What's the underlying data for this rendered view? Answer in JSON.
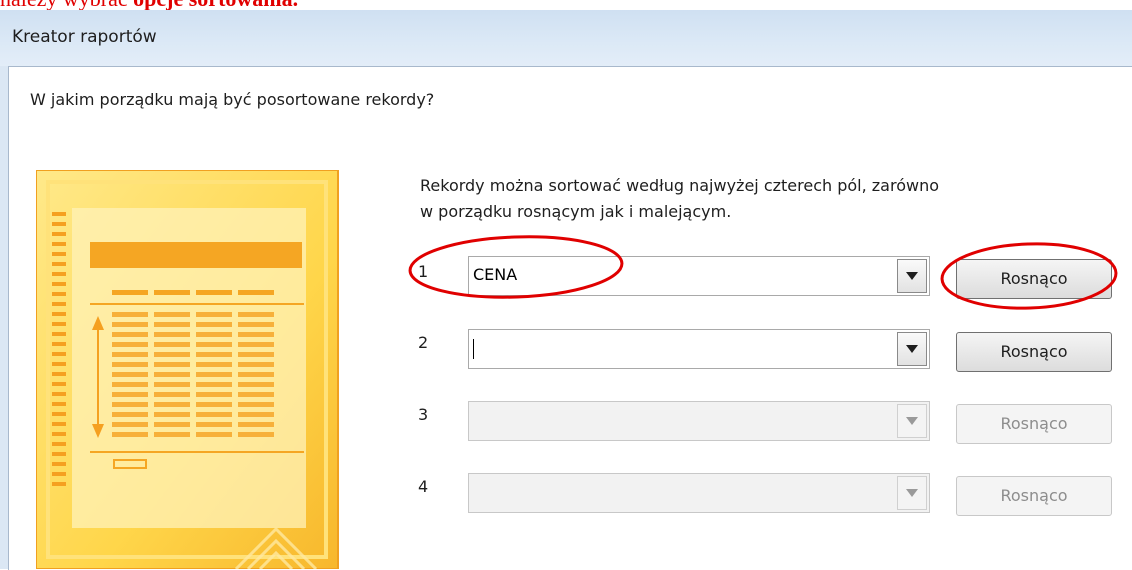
{
  "caption": {
    "plain": "należy wybrać ",
    "bold": "opcje sortowania."
  },
  "window": {
    "title": "Kreator raportów"
  },
  "question": "W jakim porządku mają być posortowane rekordy?",
  "description": "Rekordy można sortować według najwyżej czterech pól, zarówno w porządku rosnącym jak i malejącym.",
  "sort_rows": [
    {
      "number": "1",
      "field": "CENA",
      "order": "Rosnąco",
      "enabled": true
    },
    {
      "number": "2",
      "field": "",
      "order": "Rosnąco",
      "enabled": true
    },
    {
      "number": "3",
      "field": "",
      "order": "Rosnąco",
      "enabled": false
    },
    {
      "number": "4",
      "field": "",
      "order": "Rosnąco",
      "enabled": false
    }
  ],
  "icons": {
    "dropdown": "chevron-down-icon",
    "illustration": "report-layout-illustration"
  },
  "colors": {
    "annotation": "#e00000",
    "illustration_fill": "#ffd84a",
    "illustration_accent": "#f5a623",
    "title_bar": "#dbe7f4"
  }
}
